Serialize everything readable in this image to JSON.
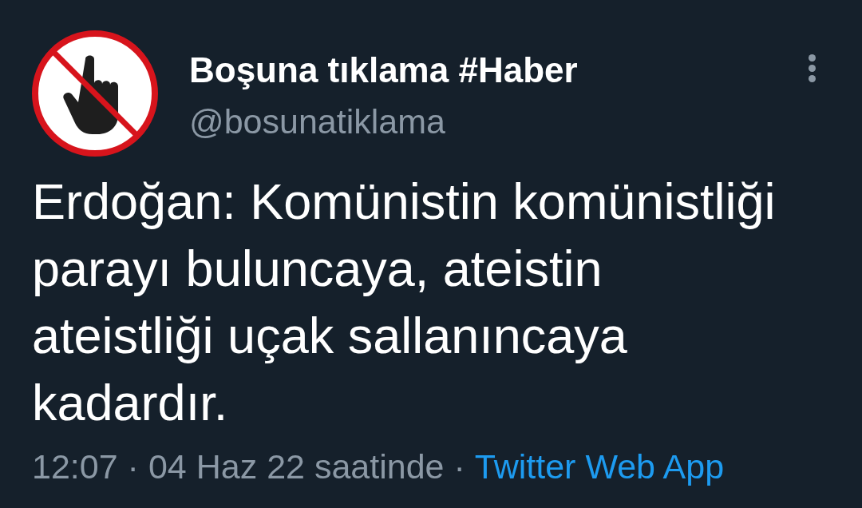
{
  "tweet": {
    "author": {
      "name": "Boşuna tıklama #Haber",
      "handle": "@bosunatiklama"
    },
    "text": "Erdoğan: Komünistin komünistliği parayı buluncaya, ateistin ateistliği uçak sallanıncaya kadardır.",
    "footer": [
      {
        "kind": "text",
        "text": "12:07"
      },
      {
        "kind": "separator",
        "text": "·"
      },
      {
        "kind": "text",
        "text": "04 Haz 22 saatinde"
      },
      {
        "kind": "separator",
        "text": "·"
      },
      {
        "kind": "link",
        "text": "Twitter Web App"
      }
    ]
  }
}
